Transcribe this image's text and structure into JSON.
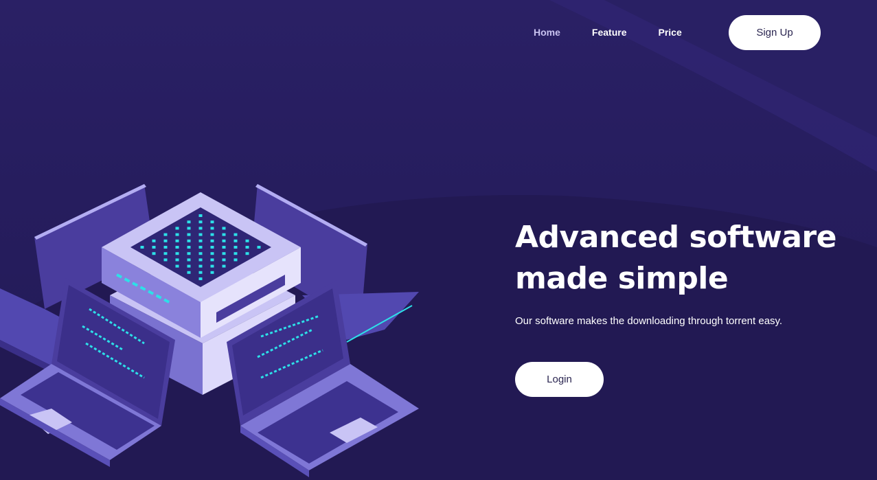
{
  "nav": {
    "items": [
      {
        "label": "Home"
      },
      {
        "label": "Feature"
      },
      {
        "label": "Price"
      }
    ],
    "signup_label": "Sign Up"
  },
  "hero": {
    "title": "Advanced software made simple",
    "subtitle": "Our software makes the downloading through torrent easy.",
    "login_label": "Login"
  },
  "illustration": {
    "icon": "server-laptops-illustration"
  },
  "colors": {
    "background": "#261d5e",
    "button_bg": "#ffffff",
    "button_text": "#2a2550",
    "accent_cyan": "#2de0e8",
    "laptop_light": "#b8b2f0"
  }
}
